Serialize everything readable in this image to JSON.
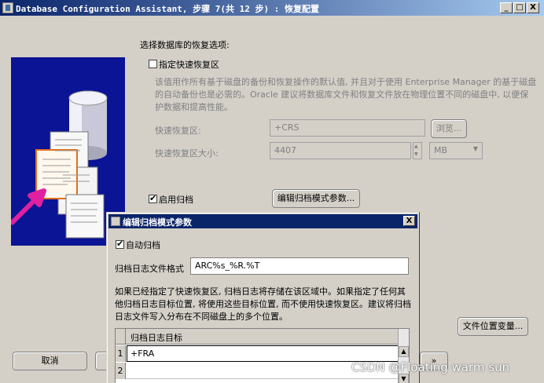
{
  "window": {
    "title": "Database Configuration Assistant, 步骤 7(共 12 步) : 恢复配置",
    "minimize": "_",
    "maximize": "□",
    "close": "X"
  },
  "recovery": {
    "heading": "选择数据库的恢复选项:",
    "fra_checkbox_label": "指定快速恢复区",
    "fra_checked": false,
    "description_line1": "该值用作所有基于磁盘的备份和恢复操作的默认值, 并且对于使用 Enterprise Manager 的基于磁盘",
    "description_line2": "的自动备份也是必需的。Oracle 建议将数据库文件和恢复文件放在物理位置不同的磁盘中, 以便保",
    "description_line3": "护数据和提高性能。",
    "fra_location_label": "快速恢复区:",
    "fra_location_value": "+CRS",
    "browse_button": "浏览...",
    "fra_size_label": "快速恢复区大小:",
    "fra_size_value": "4407",
    "fra_size_unit": "MB",
    "archive_checkbox_label": "启用归档",
    "archive_checked": true,
    "edit_archive_button": "编辑归档模式参数...",
    "file_locations_button": "文件位置变量..."
  },
  "nav": {
    "cancel_button": "取消",
    "next_arrow": "»"
  },
  "dialog": {
    "title": "编辑归档模式参数",
    "close": "X",
    "auto_archive_label": "自动归档",
    "auto_archive_checked": true,
    "log_format_label": "归档日志文件格式",
    "log_format_value": "ARC%s_%R.%T",
    "note_line1": "如果已经指定了快速恢复区, 归档日志将存储在该区域中。如果指定了任何其",
    "note_line2": "他归档日志目标位置, 将使用这些目标位置, 而不使用快速恢复区。建议将归档",
    "note_line3": "日志文件写入分布在不同磁盘上的多个位置。",
    "table_header": "归档日志目标",
    "rows": [
      {
        "num": "1",
        "value": "+FRA"
      },
      {
        "num": "2",
        "value": ""
      }
    ]
  },
  "watermark": "CSDN @Floating warm sun",
  "colors": {
    "titlebar_start": "#0a246a",
    "titlebar_end": "#a6caf0",
    "illustration_bg": "#0a1494",
    "window_bg": "#d4d0c8"
  }
}
